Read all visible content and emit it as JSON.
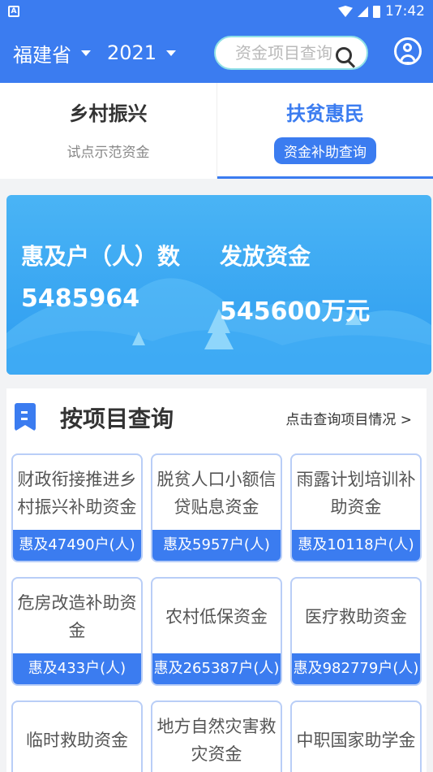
{
  "status_bar": {
    "time": "17:42"
  },
  "header": {
    "province": "福建省",
    "year": "2021",
    "search_placeholder": "资金项目查询"
  },
  "tabs": [
    {
      "title": "乡村振兴",
      "subtitle": "试点示范资金",
      "active": false
    },
    {
      "title": "扶贫惠民",
      "subtitle": "资金补助查询",
      "active": true
    }
  ],
  "banner": {
    "households_label": "惠及户（人）数",
    "households_value": "5485964",
    "funds_label": "发放资金",
    "funds_value": "545600万元"
  },
  "section": {
    "title": "按项目查询",
    "link": "点击查询项目情况 >"
  },
  "projects": [
    {
      "name": "财政衔接推进乡村振兴补助资金",
      "stat": "惠及47490户(人)"
    },
    {
      "name": "脱贫人口小额信贷贴息资金",
      "stat": "惠及5957户(人)"
    },
    {
      "name": "雨露计划培训补助资金",
      "stat": "惠及10118户(人)"
    },
    {
      "name": "危房改造补助资金",
      "stat": "惠及433户(人)"
    },
    {
      "name": "农村低保资金",
      "stat": "惠及265387户(人)"
    },
    {
      "name": "医疗救助资金",
      "stat": "惠及982779户(人)"
    },
    {
      "name": "临时救助资金",
      "stat": ""
    },
    {
      "name": "地方自然灾害救灾资金",
      "stat": ""
    },
    {
      "name": "中职国家助学金",
      "stat": ""
    }
  ],
  "colors": {
    "primary": "#3b7cf0",
    "banner_top": "#4ab4f5",
    "card_border": "#b9cef7"
  }
}
